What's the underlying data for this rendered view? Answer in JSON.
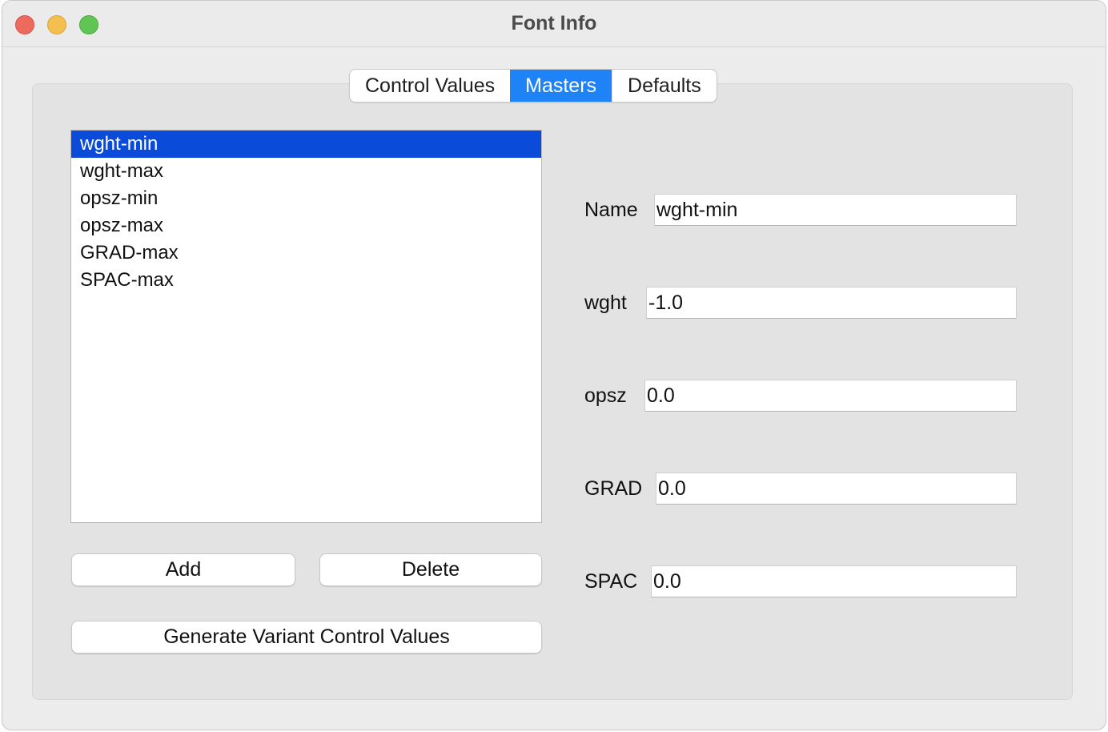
{
  "window": {
    "title": "Font Info"
  },
  "tabs": [
    {
      "label": "Control Values",
      "active": false
    },
    {
      "label": "Masters",
      "active": true
    },
    {
      "label": "Defaults",
      "active": false
    }
  ],
  "masters": {
    "items": [
      "wght-min",
      "wght-max",
      "opsz-min",
      "opsz-max",
      "GRAD-max",
      "SPAC-max"
    ],
    "selected_index": 0
  },
  "buttons": {
    "add": "Add",
    "delete": "Delete",
    "generate": "Generate Variant Control Values"
  },
  "fields": {
    "name": {
      "label": "Name",
      "value": "wght-min"
    },
    "wght": {
      "label": "wght",
      "value": "-1.0"
    },
    "opsz": {
      "label": "opsz",
      "value": "0.0"
    },
    "grad": {
      "label": "GRAD",
      "value": "0.0"
    },
    "spac": {
      "label": "SPAC",
      "value": "0.0"
    }
  },
  "colors": {
    "accent": "#1e83f6",
    "selection": "#0a4bd9",
    "close": "#ed6a5e",
    "minimize": "#f5bf4f",
    "maximize": "#61c554"
  }
}
